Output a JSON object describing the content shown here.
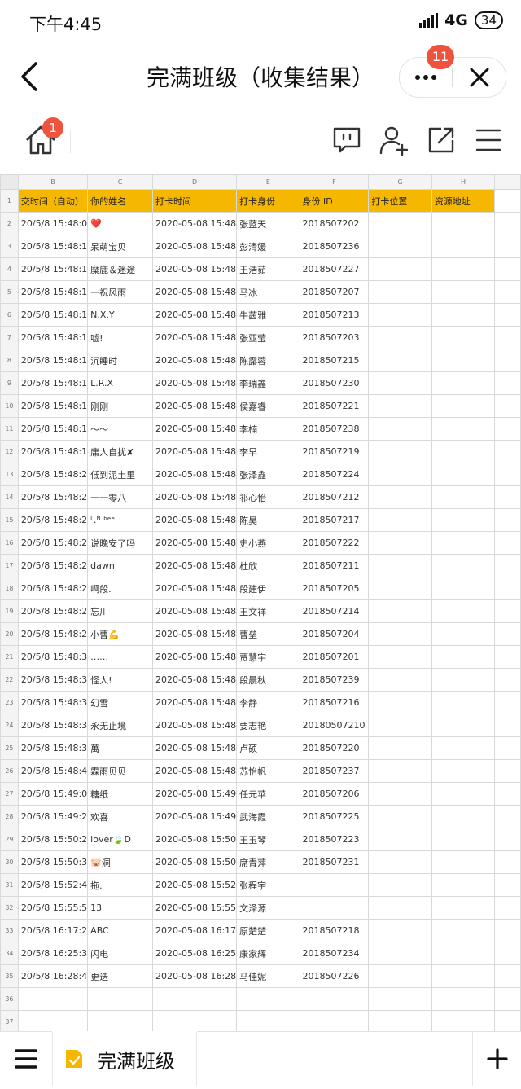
{
  "status": {
    "time": "下午4:45",
    "network": "4G",
    "battery": "34"
  },
  "title_bar": {
    "title": "完满班级（收集结果）",
    "more_badge": "11"
  },
  "toolbar": {
    "home_badge": "1"
  },
  "sheet": {
    "column_letters": [
      "B",
      "C",
      "D",
      "E",
      "F",
      "G",
      "H",
      ""
    ],
    "headers": [
      "交时间（自动）",
      "你的姓名",
      "打卡时间",
      "打卡身份",
      "身份 ID",
      "打卡位置",
      "资源地址",
      ""
    ],
    "rows": [
      [
        "20/5/8 15:48:0",
        "❤️",
        "2020-05-08 15:48",
        "张蓝天",
        "2018507202",
        "",
        "",
        ""
      ],
      [
        "20/5/8 15:48:1",
        "呆萌宝贝",
        "2020-05-08 15:48",
        "彭清媛",
        "2018507236",
        "",
        "",
        ""
      ],
      [
        "20/5/8 15:48:1",
        "糜鹿＆迷途",
        "2020-05-08 15:48",
        "王浩茹",
        "2018507227",
        "",
        "",
        ""
      ],
      [
        "20/5/8 15:48:1",
        "一祝风雨",
        "2020-05-08 15:48",
        "马冰",
        "2018507207",
        "",
        "",
        ""
      ],
      [
        "20/5/8 15:48:1",
        "N.X.Y",
        "2020-05-08 15:48",
        "牛茜雅",
        "2018507213",
        "",
        "",
        ""
      ],
      [
        "20/5/8 15:48:1",
        "嘘!",
        "2020-05-08 15:48",
        "张亚莹",
        "2018507203",
        "",
        "",
        ""
      ],
      [
        "20/5/8 15:48:1",
        "沉睡时",
        "2020-05-08 15:48",
        "陈露蓉",
        "2018507215",
        "",
        "",
        ""
      ],
      [
        "20/5/8 15:48:1",
        "L.R.X",
        "2020-05-08 15:48",
        "李瑞鑫",
        "2018507230",
        "",
        "",
        ""
      ],
      [
        "20/5/8 15:48:1",
        "刚刚",
        "2020-05-08 15:48",
        "侯嘉睿",
        "2018507221",
        "",
        "",
        ""
      ],
      [
        "20/5/8 15:48:1",
        "～～",
        "2020-05-08 15:48",
        "李楠",
        "2018507238",
        "",
        "",
        ""
      ],
      [
        "20/5/8 15:48:1",
        "庸人自扰✘",
        "2020-05-08 15:48",
        "李早",
        "2018507219",
        "",
        "",
        ""
      ],
      [
        "20/5/8 15:48:2",
        "低到泥土里",
        "2020-05-08 15:48",
        "张泽鑫",
        "2018507224",
        "",
        "",
        ""
      ],
      [
        "20/5/8 15:48:2",
        "一一零八",
        "2020-05-08 15:48",
        "祁心怡",
        "2018507212",
        "",
        "",
        ""
      ],
      [
        "20/5/8 15:48:2",
        "ᴸ.ᴺ ᵇᵉᵉ",
        "2020-05-08 15:48",
        "陈昊",
        "2018507217",
        "",
        "",
        ""
      ],
      [
        "20/5/8 15:48:2",
        "说晚安了吗",
        "2020-05-08 15:48",
        "史小燕",
        "2018507222",
        "",
        "",
        ""
      ],
      [
        "20/5/8 15:48:2",
        "dawn",
        "2020-05-08 15:48",
        "杜欣",
        "2018507211",
        "",
        "",
        ""
      ],
      [
        "20/5/8 15:48:2",
        "啊段.",
        "2020-05-08 15:48",
        "段建伊",
        "2018507205",
        "",
        "",
        ""
      ],
      [
        "20/5/8 15:48:2",
        "忘川",
        "2020-05-08 15:48",
        "王文祥",
        "2018507214",
        "",
        "",
        ""
      ],
      [
        "20/5/8 15:48:2",
        "小曹💪",
        "2020-05-08 15:48",
        "曹垒",
        "2018507204",
        "",
        "",
        ""
      ],
      [
        "20/5/8 15:48:3",
        "……",
        "2020-05-08 15:48",
        "贾慧宇",
        "2018507201",
        "",
        "",
        ""
      ],
      [
        "20/5/8 15:48:3",
        "怪人!",
        "2020-05-08 15:48",
        "段晨秋",
        "2018507239",
        "",
        "",
        ""
      ],
      [
        "20/5/8 15:48:3",
        "幻雪",
        "2020-05-08 15:48",
        "李静",
        "2018507216",
        "",
        "",
        ""
      ],
      [
        "20/5/8 15:48:3",
        "永无止境",
        "2020-05-08 15:48",
        "要志艳",
        "20180507210",
        "",
        "",
        ""
      ],
      [
        "20/5/8 15:48:3",
        "萬",
        "2020-05-08 15:48",
        "卢硕",
        "2018507220",
        "",
        "",
        ""
      ],
      [
        "20/5/8 15:48:4",
        "霖雨贝贝",
        "2020-05-08 15:48",
        "苏怡帆",
        "2018507237",
        "",
        "",
        ""
      ],
      [
        "20/5/8 15:49:0",
        "糖纸",
        "2020-05-08 15:49",
        "任元苹",
        "2018507206",
        "",
        "",
        ""
      ],
      [
        "20/5/8 15:49:2",
        "欢喜",
        "2020-05-08 15:49",
        "武海霞",
        "2018507225",
        "",
        "",
        ""
      ],
      [
        "20/5/8 15:50:2",
        "lover🍃D",
        "2020-05-08 15:50",
        "王玉琴",
        "2018507223",
        "",
        "",
        ""
      ],
      [
        "20/5/8 15:50:3",
        "🐷洞",
        "2020-05-08 15:50",
        "席青萍",
        "2018507231",
        "",
        "",
        ""
      ],
      [
        "20/5/8 15:52:4",
        "拖.",
        "2020-05-08 15:52",
        "张程宇",
        "",
        "",
        "",
        ""
      ],
      [
        "20/5/8 15:55:5",
        "13",
        "2020-05-08 15:55",
        "文泽源",
        "",
        "",
        "",
        ""
      ],
      [
        "20/5/8 16:17:2",
        "ABC",
        "2020-05-08 16:17",
        "原楚楚",
        "2018507218",
        "",
        "",
        ""
      ],
      [
        "20/5/8 16:25:3",
        "闪电",
        "2020-05-08 16:25",
        "康家辉",
        "2018507234",
        "",
        "",
        ""
      ],
      [
        "20/5/8 16:28:4",
        "更迭",
        "2020-05-08 16:28",
        "马佳妮",
        "2018507226",
        "",
        "",
        ""
      ],
      [
        "",
        "",
        "",
        "",
        "",
        "",
        "",
        ""
      ],
      [
        "",
        "",
        "",
        "",
        "",
        "",
        "",
        ""
      ],
      [
        "",
        "",
        "",
        "",
        "",
        "",
        "",
        ""
      ]
    ]
  },
  "bottom": {
    "sheet_tab": "完满班级"
  },
  "colors": {
    "header_fill": "#f6b700",
    "badge": "#f0533d"
  },
  "icons": [
    "back-arrow-icon",
    "more-dots-icon",
    "close-icon",
    "home-icon",
    "comment-icon",
    "add-user-icon",
    "share-icon",
    "menu-icon",
    "sheet-file-icon",
    "plus-icon"
  ]
}
